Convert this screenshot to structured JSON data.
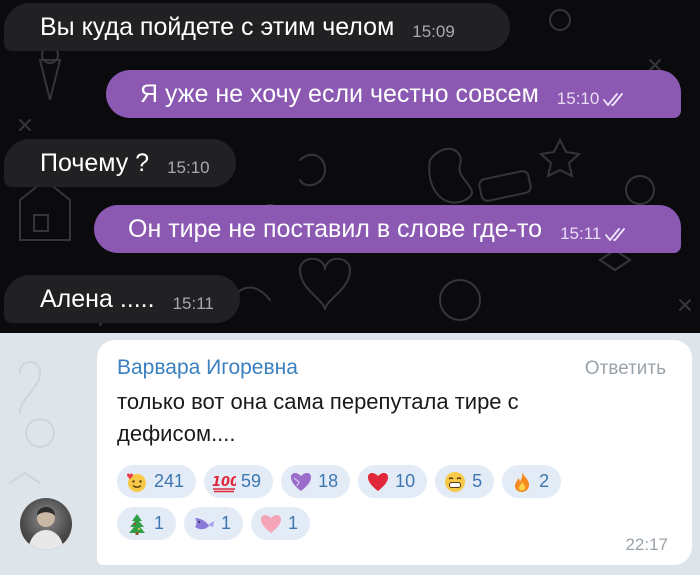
{
  "dark_chat": {
    "messages": [
      {
        "direction": "in",
        "text": "Вы куда пойдете с этим челом",
        "time": "15:09"
      },
      {
        "direction": "out",
        "text": "Я уже не хочу если честно совсем",
        "time": "15:10",
        "read": true
      },
      {
        "direction": "in",
        "text": "Почему ?",
        "time": "15:10"
      },
      {
        "direction": "out",
        "text": "Он тире не поставил в слове где-то",
        "time": "15:11",
        "read": true
      },
      {
        "direction": "in",
        "text": "Алена .....",
        "time": "15:11"
      }
    ],
    "colors": {
      "background": "#0b0b0d",
      "incoming_bubble": "#212124",
      "outgoing_bubble": "#8b58b2"
    }
  },
  "comment": {
    "author": "Варвара Игоревна",
    "reply_label": "Ответить",
    "text": "только вот она сама перепутала тире с дефисом....",
    "timestamp": "22:17",
    "reactions": [
      {
        "icon": "smiling-face-with-hearts-icon",
        "count": "241"
      },
      {
        "icon": "hundred-points-icon",
        "count": "59"
      },
      {
        "icon": "purple-heart-icon",
        "count": "18"
      },
      {
        "icon": "red-heart-icon",
        "count": "10"
      },
      {
        "icon": "grinning-face-icon",
        "count": "5"
      },
      {
        "icon": "fire-icon",
        "count": "2"
      },
      {
        "icon": "christmas-tree-icon",
        "count": "1"
      },
      {
        "icon": "fish-icon",
        "count": "1"
      },
      {
        "icon": "pink-heart-icon",
        "count": "1"
      }
    ],
    "colors": {
      "author": "#3a7fbf",
      "reaction_count": "#3e76b2",
      "reaction_bg": "#e3ecf6"
    }
  }
}
